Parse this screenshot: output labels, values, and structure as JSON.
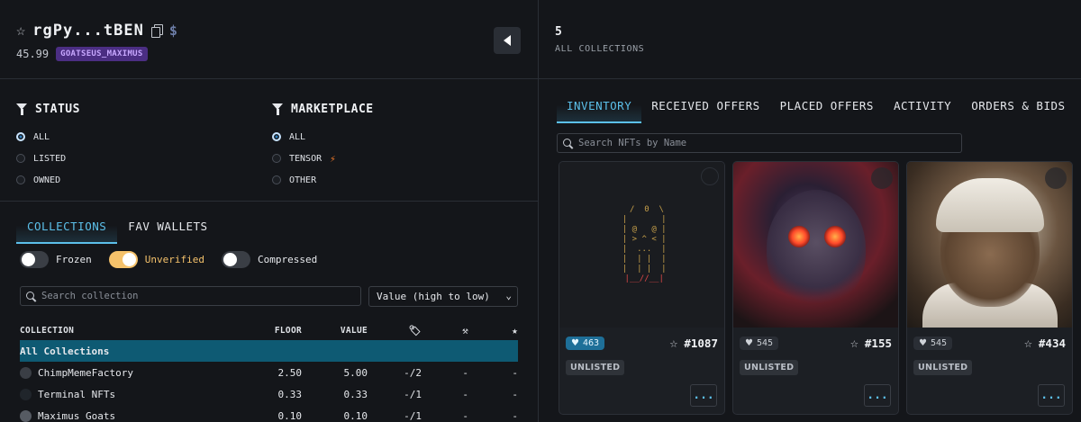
{
  "wallet": {
    "address": "rgPy...tBEN",
    "balance": "45.99",
    "tag": "GOATSEUS_MAXIMUS"
  },
  "portfolio": {
    "count": "5",
    "count_label": "ALL COLLECTIONS"
  },
  "filters": {
    "status": {
      "title": "STATUS",
      "options": [
        "ALL",
        "LISTED",
        "OWNED"
      ],
      "selected": "ALL"
    },
    "marketplace": {
      "title": "MARKETPLACE",
      "options": [
        "ALL",
        "TENSOR",
        "OTHER"
      ],
      "selected": "ALL"
    }
  },
  "left_tabs": [
    "COLLECTIONS",
    "FAV WALLETS"
  ],
  "toggles": [
    {
      "label": "Frozen",
      "on": false
    },
    {
      "label": "Unverified",
      "on": true
    },
    {
      "label": "Compressed",
      "on": false
    }
  ],
  "collection_search": {
    "placeholder": "Search collection"
  },
  "sort": {
    "value": "Value (high to low)"
  },
  "table": {
    "headers": [
      "COLLECTION",
      "FLOOR",
      "VALUE"
    ],
    "all_label": "All Collections",
    "rows": [
      {
        "name": "ChimpMemeFactory",
        "floor": "2.50",
        "value": "5.00",
        "listed": "-/2",
        "bids": "-",
        "fav": "-"
      },
      {
        "name": "Terminal NFTs",
        "floor": "0.33",
        "value": "0.33",
        "listed": "-/1",
        "bids": "-",
        "fav": "-"
      },
      {
        "name": "Maximus Goats",
        "floor": "0.10",
        "value": "0.10",
        "listed": "-/1",
        "bids": "-",
        "fav": "-"
      }
    ]
  },
  "right_tabs": [
    "INVENTORY",
    "RECEIVED OFFERS",
    "PLACED OFFERS",
    "ACTIVITY",
    "ORDERS & BIDS"
  ],
  "nft_search": {
    "placeholder": "Search NFTs by Name"
  },
  "nfts": [
    {
      "likes": "463",
      "rank": "#1087",
      "status": "UNLISTED",
      "more": "..."
    },
    {
      "likes": "545",
      "rank": "#155",
      "status": "UNLISTED",
      "more": "..."
    },
    {
      "likes": "545",
      "rank": "#434",
      "status": "UNLISTED",
      "more": "..."
    }
  ],
  "colors": {
    "accent": "#5cc0ea",
    "tag_bg": "#4b2e83",
    "tag_fg": "#c8a8ff",
    "toggle_on": "#f5c26b",
    "selected_row": "#0e5a73"
  }
}
